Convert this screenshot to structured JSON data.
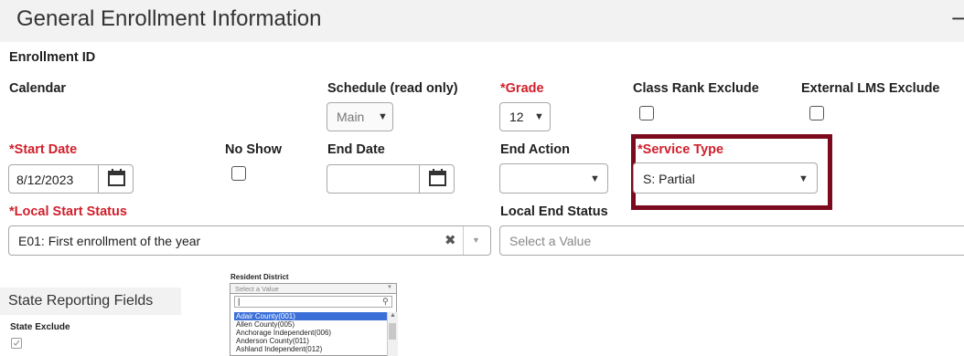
{
  "section": {
    "title": "General Enrollment Information",
    "collapse_symbol": "−"
  },
  "fields": {
    "enrollment_id": "Enrollment ID",
    "calendar": "Calendar",
    "schedule": {
      "label": "Schedule (read only)",
      "value": "Main"
    },
    "grade": {
      "required_mark": "*",
      "label": "Grade",
      "value": "12"
    },
    "class_rank_exclude": "Class Rank Exclude",
    "external_lms_exclude": "External LMS Exclude",
    "start_date": {
      "required_mark": "*",
      "label": "Start Date",
      "value": "8/12/2023"
    },
    "no_show": "No Show",
    "end_date": {
      "label": "End Date",
      "value": ""
    },
    "end_action": {
      "label": "End Action",
      "value": ""
    },
    "service_type": {
      "required_mark": "*",
      "label": "Service Type",
      "value": "S: Partial"
    },
    "local_start_status": {
      "required_mark": "*",
      "label": "Local Start Status",
      "value": "E01: First enrollment of the year"
    },
    "local_end_status": {
      "label": "Local End Status",
      "placeholder": "Select a Value"
    }
  },
  "state_reporting": {
    "title": "State Reporting Fields",
    "state_exclude": "State Exclude"
  },
  "resident_district": {
    "label": "Resident District",
    "placeholder": "Select a Value",
    "search_text": "|",
    "options": [
      "Adair County(001)",
      "Allen County(005)",
      "Anchorage Independent(006)",
      "Anderson County(011)",
      "Ashland Independent(012)"
    ]
  },
  "colors": {
    "required": "#d0202c",
    "highlight_border": "#7b0a1e",
    "selected_option": "#3b6fd8"
  }
}
